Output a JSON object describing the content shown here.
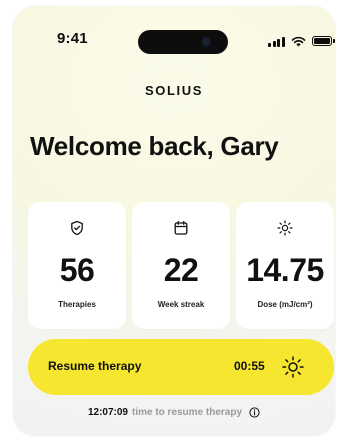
{
  "status_bar": {
    "time": "9:41",
    "icons": [
      "signal-icon",
      "wifi-icon",
      "battery-icon"
    ]
  },
  "brand": {
    "logo_text": "SOLIUS"
  },
  "welcome": {
    "title": "Welcome back, Gary"
  },
  "stats": [
    {
      "icon": "shield-check-icon",
      "value": "56",
      "label": "Therapies"
    },
    {
      "icon": "calendar-icon",
      "value": "22",
      "label": "Week streak"
    },
    {
      "icon": "sun-icon",
      "value": "14.75",
      "label": "Dose (mJ/cm²)"
    }
  ],
  "resume": {
    "label": "Resume therapy",
    "timer": "00:55",
    "icon": "sun-icon",
    "background_color": "#f7e62f"
  },
  "footer": {
    "time": "12:07:09",
    "text": "time to resume therapy",
    "icon": "info-icon"
  }
}
